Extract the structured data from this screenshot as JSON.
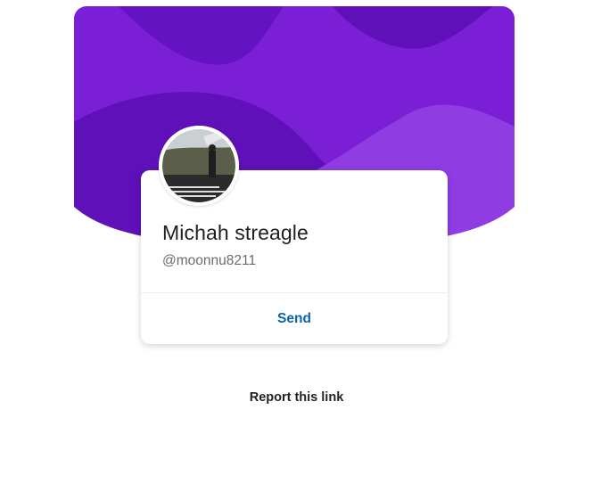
{
  "profile": {
    "name": "Michah streagle",
    "handle": "@moonnu8211",
    "avatar_alt": "Profile photo of Michah streagle"
  },
  "card": {
    "send_label": "Send"
  },
  "footer": {
    "report_label": "Report this link"
  },
  "colors": {
    "banner_primary": "#7b1fd6",
    "banner_dark": "#5f10b8",
    "banner_light": "#8f3de3",
    "send_link": "#0b63ad",
    "name_text": "#1f1f1f",
    "handle_text": "#6b6b6b"
  }
}
